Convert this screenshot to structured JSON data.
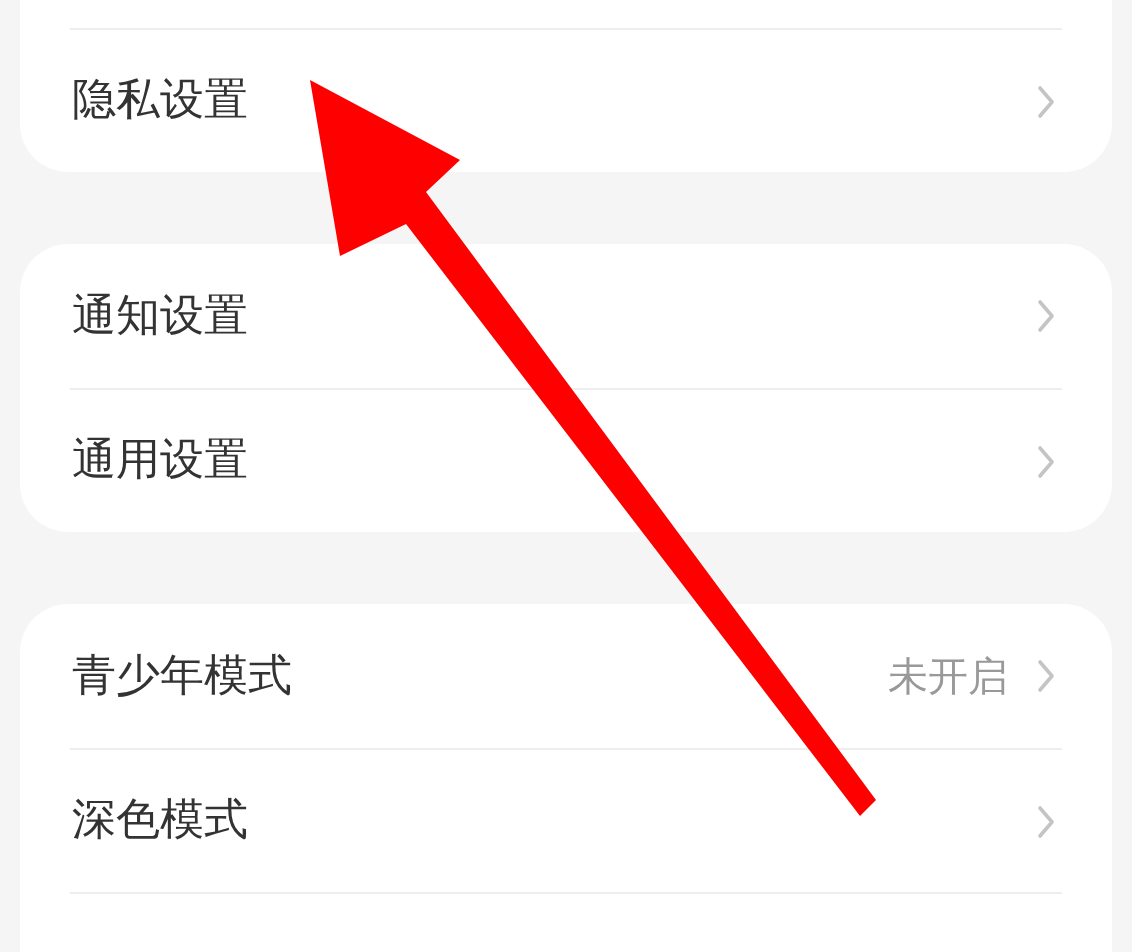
{
  "groups": [
    {
      "items": [
        {
          "label": "隐私设置"
        }
      ]
    },
    {
      "items": [
        {
          "label": "通知设置"
        },
        {
          "label": "通用设置"
        }
      ]
    },
    {
      "items": [
        {
          "label": "青少年模式",
          "value": "未开启"
        },
        {
          "label": "深色模式"
        }
      ]
    }
  ]
}
